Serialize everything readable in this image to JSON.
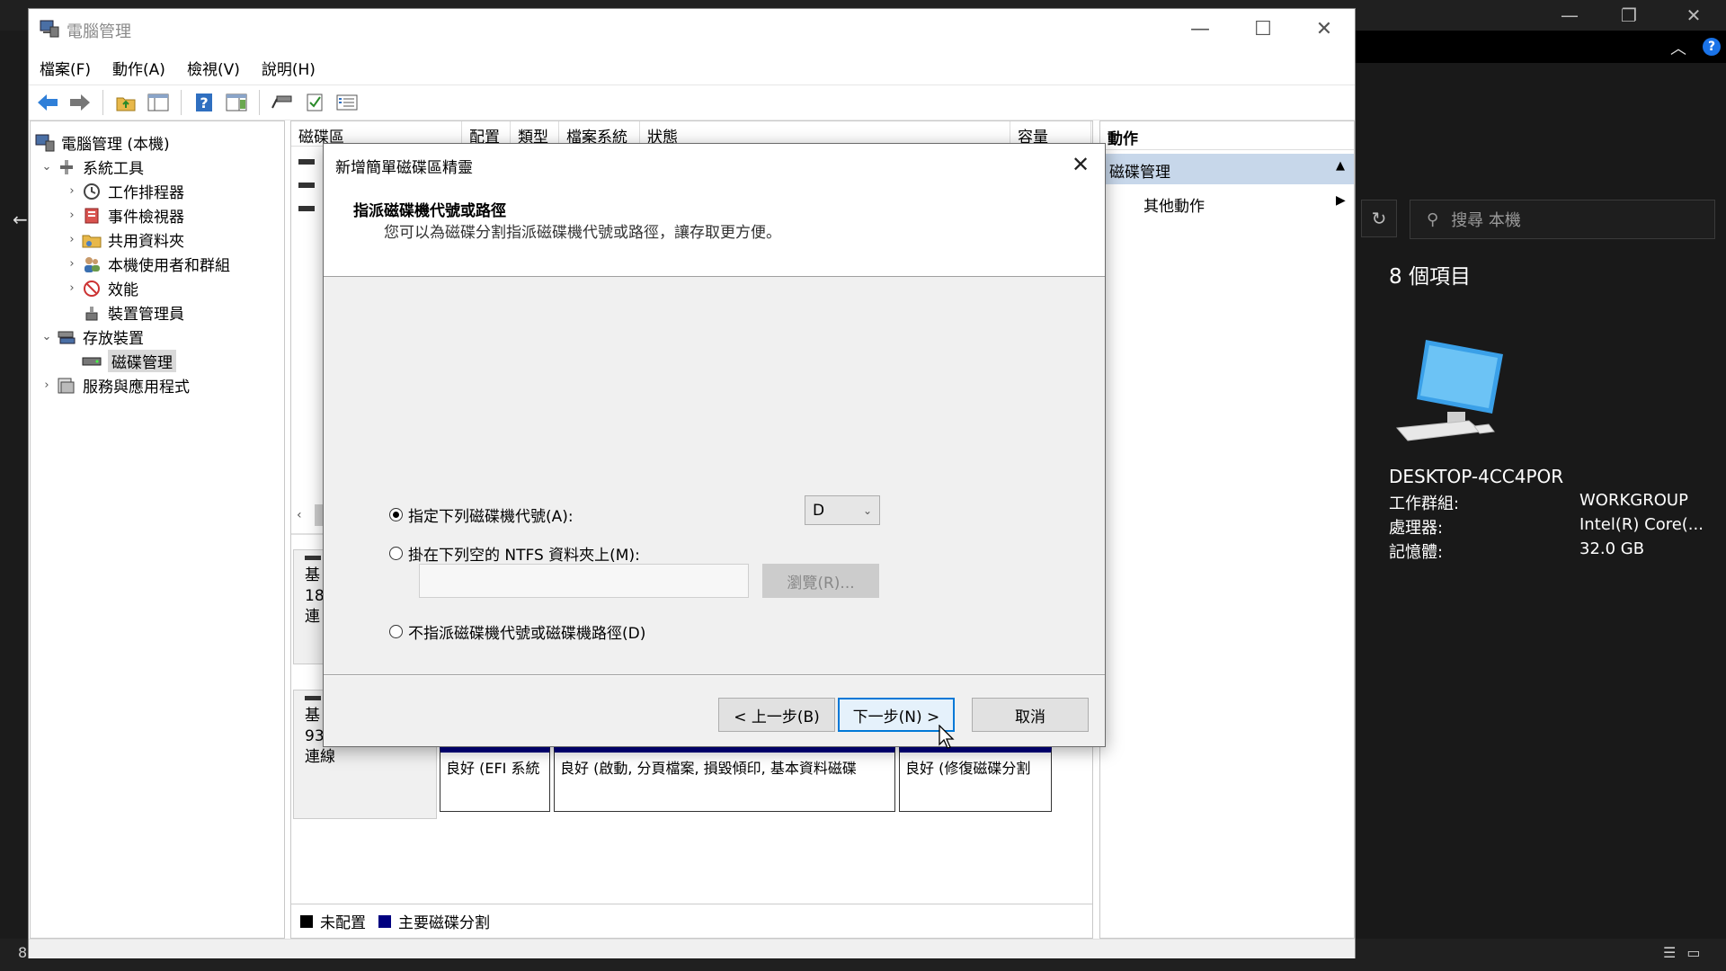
{
  "background_window": {
    "item_count": "8 個項目",
    "search_placeholder": "搜尋 本機",
    "computer_name": "DESKTOP-4CC4POR",
    "properties": [
      {
        "key": "工作群組:",
        "value": "WORKGROUP"
      },
      {
        "key": "處理器:",
        "value": "Intel(R) Core(..."
      },
      {
        "key": "記憶體:",
        "value": "32.0 GB"
      }
    ],
    "status_text": "8"
  },
  "mmc": {
    "title": "電腦管理",
    "menu": [
      "檔案(F)",
      "動作(A)",
      "檢視(V)",
      "說明(H)"
    ],
    "tree": {
      "root": "電腦管理 (本機)",
      "system_tools": "系統工具",
      "task_scheduler": "工作排程器",
      "event_viewer": "事件檢視器",
      "shared_folders": "共用資料夾",
      "local_users": "本機使用者和群組",
      "performance": "效能",
      "device_manager": "裝置管理員",
      "storage": "存放裝置",
      "disk_management": "磁碟管理",
      "services_apps": "服務與應用程式"
    },
    "columns": [
      "磁碟區",
      "配置",
      "類型",
      "檔案系統",
      "狀態",
      "容量"
    ],
    "disk_rows": [
      {
        "lines": [
          "基",
          "18",
          "連"
        ]
      },
      {
        "lines": [
          "基",
          "93",
          "連線"
        ]
      }
    ],
    "partitions": [
      {
        "status": "良好 (EFI 系統"
      },
      {
        "status": "良好 (啟動, 分頁檔案, 損毀傾印, 基本資料磁碟"
      },
      {
        "status": "良好 (修復磁碟分割"
      }
    ],
    "legend": [
      {
        "label": "未配置",
        "color": "#000000"
      },
      {
        "label": "主要磁碟分割",
        "color": "#000080"
      }
    ],
    "actions": {
      "header": "動作",
      "group": "磁碟管理",
      "more": "其他動作"
    }
  },
  "wizard": {
    "title": "新增簡單磁碟區精靈",
    "heading": "指派磁碟機代號或路徑",
    "subtitle": "您可以為磁碟分割指派磁碟機代號或路徑，讓存取更方便。",
    "option_letter": "指定下列磁碟機代號(A):",
    "selected_letter": "D",
    "option_ntfs": "掛在下列空的 NTFS 資料夾上(M):",
    "ntfs_path": "",
    "browse_label": "瀏覽(R)...",
    "option_none": "不指派磁碟機代號或磁碟機路徑(D)",
    "selected_option": "letter",
    "back_label": "< 上一步(B)",
    "next_label": "下一步(N) >",
    "cancel_label": "取消"
  }
}
